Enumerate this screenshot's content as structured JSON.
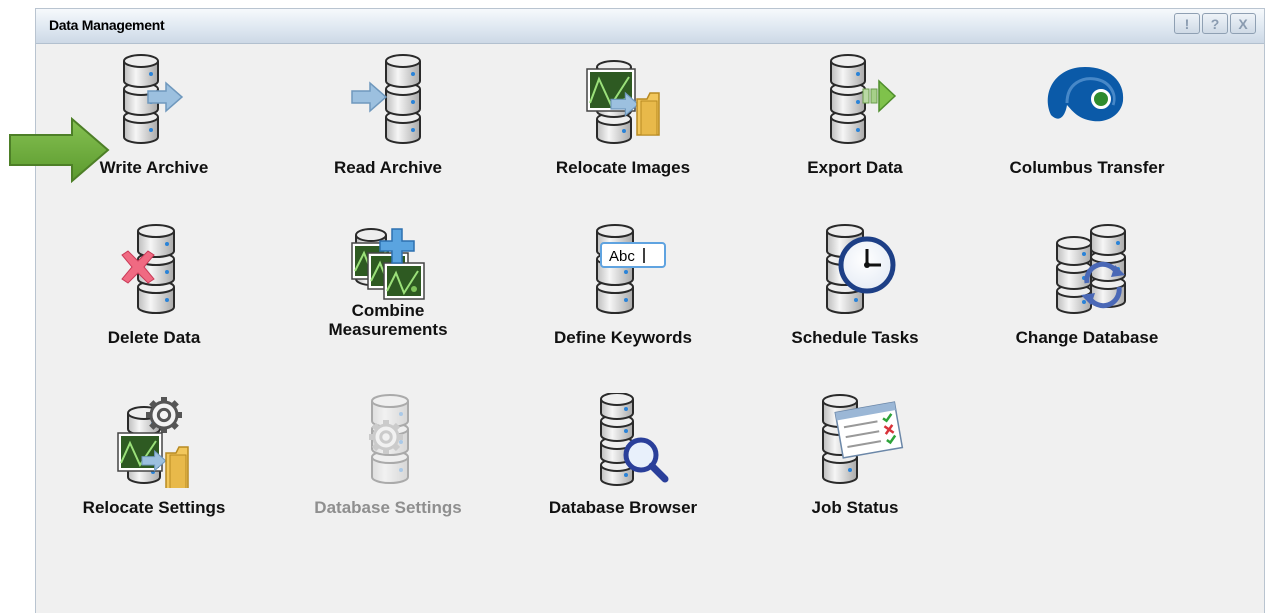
{
  "window": {
    "title": "Data Management",
    "controls": [
      {
        "name": "alert",
        "glyph": "!"
      },
      {
        "name": "help",
        "glyph": "?"
      },
      {
        "name": "close",
        "glyph": "X"
      }
    ]
  },
  "tiles": [
    {
      "label": "Write Archive",
      "icon": "write-archive-icon",
      "enabled": true
    },
    {
      "label": "Read Archive",
      "icon": "read-archive-icon",
      "enabled": true
    },
    {
      "label": "Relocate Images",
      "icon": "relocate-images-icon",
      "enabled": true
    },
    {
      "label": "Export Data",
      "icon": "export-data-icon",
      "enabled": true
    },
    {
      "label": "Columbus Transfer",
      "icon": "columbus-transfer-icon",
      "enabled": true
    },
    {
      "label": "Delete Data",
      "icon": "delete-data-icon",
      "enabled": true
    },
    {
      "label": "Combine\nMeasurements",
      "icon": "combine-measurements-icon",
      "enabled": true
    },
    {
      "label": "Define Keywords",
      "icon": "define-keywords-icon",
      "enabled": true,
      "icon_text": "Abc"
    },
    {
      "label": "Schedule Tasks",
      "icon": "schedule-tasks-icon",
      "enabled": true
    },
    {
      "label": "Change Database",
      "icon": "change-database-icon",
      "enabled": true
    },
    {
      "label": "Relocate Settings",
      "icon": "relocate-settings-icon",
      "enabled": true
    },
    {
      "label": "Database Settings",
      "icon": "database-settings-icon",
      "enabled": false
    },
    {
      "label": "Database Browser",
      "icon": "database-browser-icon",
      "enabled": true
    },
    {
      "label": "Job Status",
      "icon": "job-status-icon",
      "enabled": true
    }
  ],
  "pointer_arrow": {
    "icon": "green-arrow-icon",
    "color": "#6aa33a"
  },
  "colors": {
    "accent_arrow": "#8fb4d4",
    "columbus_blue": "#0b5aa8",
    "db_gray": "#c9c9c9",
    "disabled_text": "#8f8f8f"
  }
}
